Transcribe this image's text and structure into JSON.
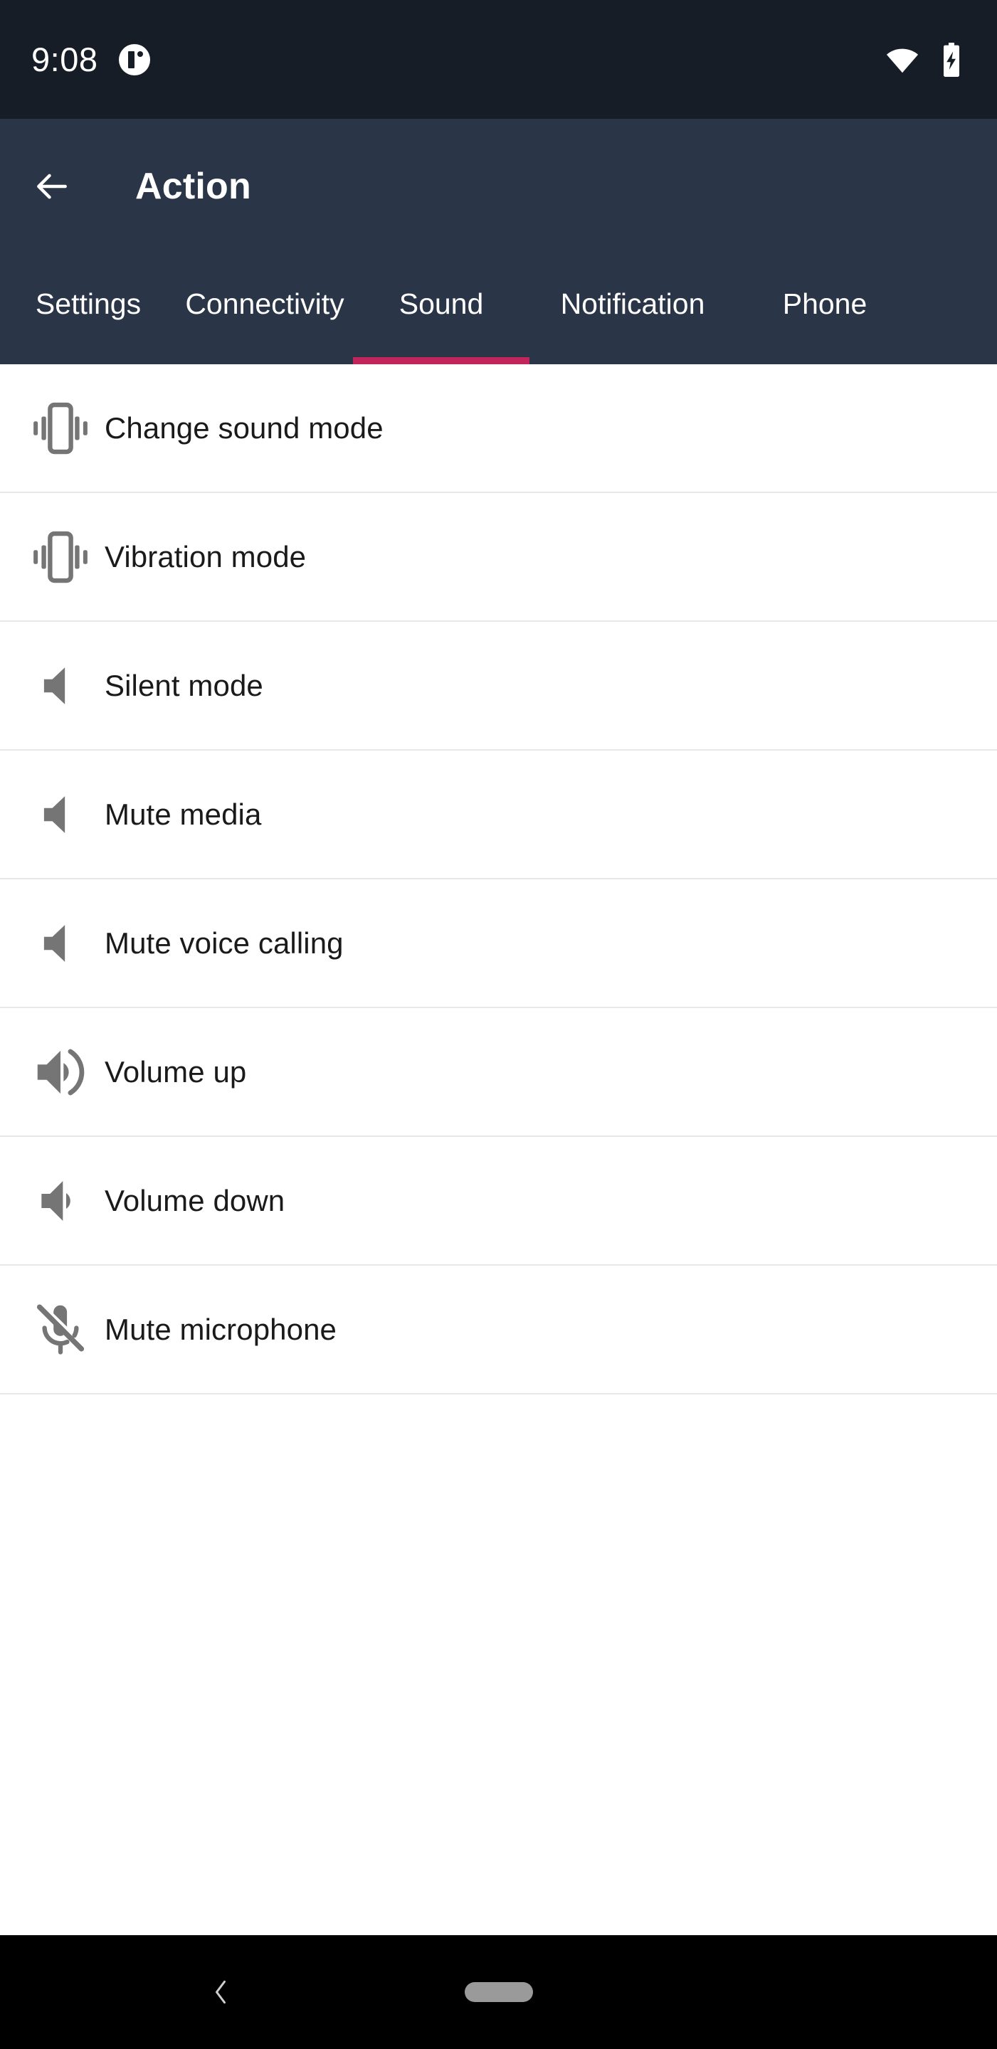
{
  "status_bar": {
    "time": "9:08",
    "app_badge_icon": "app-circle-icon",
    "wifi_icon": "wifi-icon",
    "battery_icon": "battery-charging-icon",
    "background_color": "#161d27"
  },
  "app_bar": {
    "back_icon": "arrow-left-icon",
    "title": "Action",
    "background_color": "#2a3648"
  },
  "tabs": {
    "active_index": 2,
    "accent_color": "#c2255c",
    "items": [
      {
        "label": "Settings"
      },
      {
        "label": "Connectivity"
      },
      {
        "label": "Sound"
      },
      {
        "label": "Notification"
      },
      {
        "label": "Phone"
      }
    ]
  },
  "list": {
    "items": [
      {
        "label": "Change sound mode",
        "icon": "vibration-icon"
      },
      {
        "label": "Vibration mode",
        "icon": "vibration-icon"
      },
      {
        "label": "Silent mode",
        "icon": "volume-mute-icon"
      },
      {
        "label": "Mute media",
        "icon": "volume-mute-icon"
      },
      {
        "label": "Mute voice calling",
        "icon": "volume-mute-icon"
      },
      {
        "label": "Volume up",
        "icon": "volume-up-icon"
      },
      {
        "label": "Volume down",
        "icon": "volume-down-icon"
      },
      {
        "label": "Mute microphone",
        "icon": "microphone-off-icon"
      }
    ]
  },
  "nav_bar": {
    "back_icon": "chevron-left-icon",
    "home_pill_icon": "home-pill-icon",
    "background_color": "#000000"
  }
}
